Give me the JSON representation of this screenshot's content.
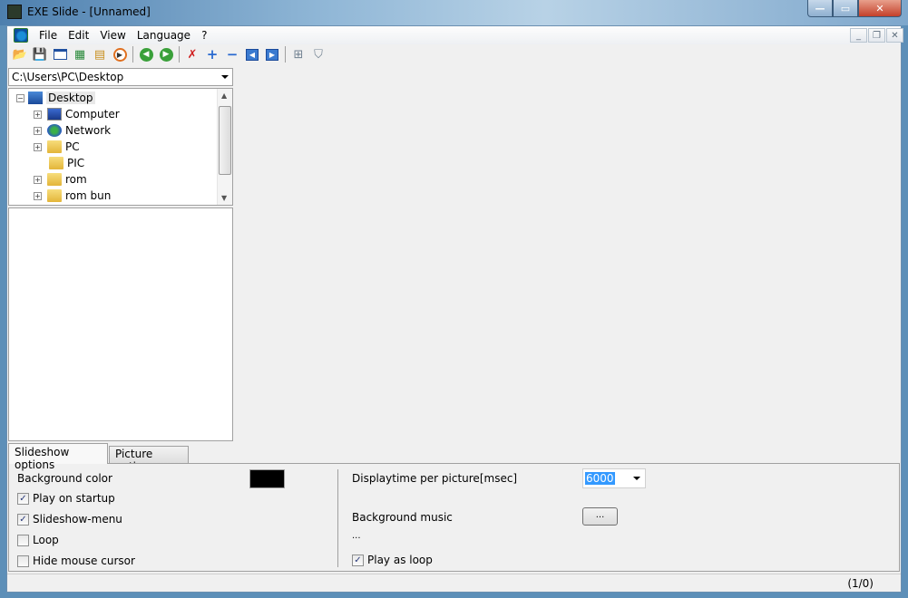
{
  "window": {
    "title": "EXE Slide - [Unnamed]",
    "min": "—",
    "max": "▭",
    "close": "✕"
  },
  "menubar": {
    "items": [
      "File",
      "Edit",
      "View",
      "Language",
      "?"
    ],
    "mdi_min": "_",
    "mdi_restore": "❐",
    "mdi_close": "✕"
  },
  "toolbar": {
    "icons": [
      "open-folder-icon",
      "save-icon",
      "window-icon",
      "image-export-icon",
      "calendar-edit-icon",
      "play-icon",
      "prev-icon",
      "next-icon",
      "delete-icon",
      "add-icon",
      "remove-icon",
      "move-left-icon",
      "move-right-icon",
      "thumbnails-icon",
      "presentation-icon"
    ]
  },
  "path": {
    "value": "C:\\Users\\PC\\Desktop"
  },
  "tree": {
    "items": [
      {
        "label": "Desktop",
        "level": 0,
        "expander": "−"
      },
      {
        "label": "Computer",
        "level": 1,
        "expander": "+"
      },
      {
        "label": "Network",
        "level": 1,
        "expander": "+"
      },
      {
        "label": "PC",
        "level": 1,
        "expander": "+"
      },
      {
        "label": "PIC",
        "level": 1,
        "expander": ""
      },
      {
        "label": "rom",
        "level": 1,
        "expander": "+"
      },
      {
        "label": "rom bun",
        "level": 1,
        "expander": "+"
      }
    ]
  },
  "tabs": {
    "slideshow": "Slideshow options",
    "picture": "Picture options"
  },
  "options": {
    "background_color_label": "Background color",
    "background_color": "#000000",
    "play_on_startup": {
      "label": "Play on startup",
      "checked": true
    },
    "slideshow_menu": {
      "label": "Slideshow-menu",
      "checked": true
    },
    "loop": {
      "label": "Loop",
      "checked": false
    },
    "hide_cursor": {
      "label": "Hide mouse cursor",
      "checked": false
    },
    "displaytime_label": "Displaytime per picture[msec]",
    "displaytime_value": "6000",
    "music_label": "Background music",
    "music_button": "...",
    "music_file": "...",
    "play_as_loop": {
      "label": "Play as loop",
      "checked": true
    }
  },
  "status": {
    "count": "(1/0)"
  },
  "check_mark": "✓"
}
